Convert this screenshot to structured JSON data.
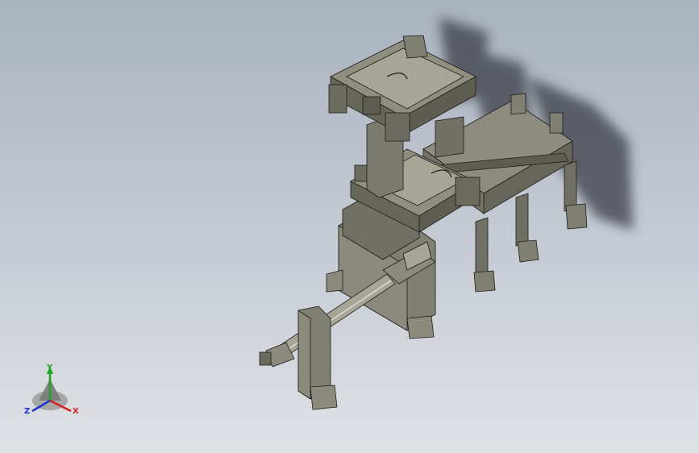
{
  "viewport": {
    "background_top": "#a9b2bf",
    "background_bottom": "#dfe1e5"
  },
  "model": {
    "part_color": "#7f7f72",
    "part_shade": "#5d5d52",
    "part_light": "#a6a596",
    "edge_color": "#1d1d1a",
    "shadow_color": "#3a3e44"
  },
  "triad": {
    "x_label": "X",
    "y_label": "Y",
    "z_label": "Z",
    "x_color": "#d62020",
    "y_color": "#1fa51f",
    "z_color": "#2030d0"
  }
}
